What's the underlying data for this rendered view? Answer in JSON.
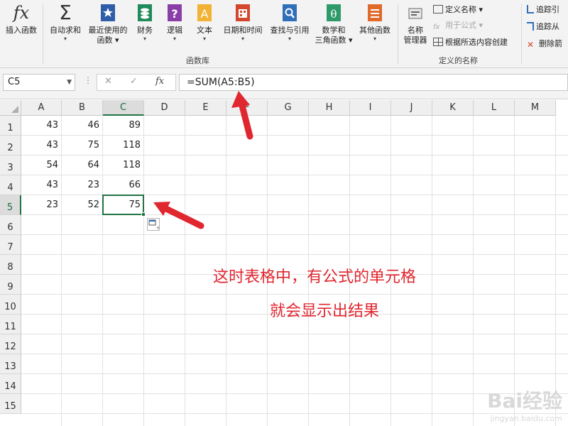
{
  "ribbon": {
    "insert_function": "插入函数",
    "autosum": "自动求和",
    "recent_line1": "最近使用的",
    "recent_line2": "函数",
    "financial": "财务",
    "logical": "逻辑",
    "text": "文本",
    "datetime": "日期和时间",
    "lookup": "查找与引用",
    "math_line1": "数学和",
    "math_line2": "三角函数",
    "more": "其他函数",
    "group_library": "函数库",
    "name_manager_line1": "名称",
    "name_manager_line2": "管理器",
    "define_name": "定义名称",
    "use_in_formula": "用于公式",
    "create_from_selection": "根据所选内容创建",
    "group_defined_names": "定义的名称",
    "trace_precedents": "追踪引",
    "trace_dependents": "追踪从",
    "remove_arrows": "删除箭"
  },
  "formula_bar": {
    "name_box": "C5",
    "cancel": "✕",
    "enter": "✓",
    "fx": "fx",
    "formula": "=SUM(A5:B5)"
  },
  "grid": {
    "columns": [
      "A",
      "B",
      "C",
      "D",
      "E",
      "F",
      "G",
      "H",
      "I",
      "J",
      "K",
      "L",
      "M"
    ],
    "rows": [
      "1",
      "2",
      "3",
      "4",
      "5",
      "6",
      "7",
      "8",
      "9",
      "10",
      "11",
      "12",
      "13",
      "14",
      "15"
    ],
    "data": [
      [
        "43",
        "46",
        "89"
      ],
      [
        "43",
        "75",
        "118"
      ],
      [
        "54",
        "64",
        "118"
      ],
      [
        "43",
        "23",
        "66"
      ],
      [
        "23",
        "52",
        "75"
      ]
    ],
    "active_cell": "C5"
  },
  "annotation": {
    "line1": "这时表格中，有公式的单元格",
    "line2": "就会显示出结果"
  },
  "watermark": {
    "brand": "Bai经验",
    "url": "jingyan.baidu.com"
  },
  "colors": {
    "accent": "#217346",
    "annotation": "#e0262f"
  }
}
